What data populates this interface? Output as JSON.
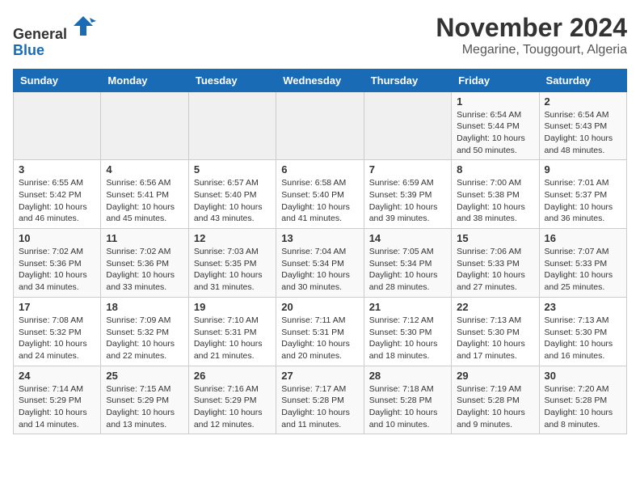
{
  "header": {
    "logo_line1": "General",
    "logo_line2": "Blue",
    "main_title": "November 2024",
    "subtitle": "Megarine, Touggourt, Algeria"
  },
  "days_of_week": [
    "Sunday",
    "Monday",
    "Tuesday",
    "Wednesday",
    "Thursday",
    "Friday",
    "Saturday"
  ],
  "weeks": [
    [
      {
        "day": "",
        "info": ""
      },
      {
        "day": "",
        "info": ""
      },
      {
        "day": "",
        "info": ""
      },
      {
        "day": "",
        "info": ""
      },
      {
        "day": "",
        "info": ""
      },
      {
        "day": "1",
        "info": "Sunrise: 6:54 AM\nSunset: 5:44 PM\nDaylight: 10 hours\nand 50 minutes."
      },
      {
        "day": "2",
        "info": "Sunrise: 6:54 AM\nSunset: 5:43 PM\nDaylight: 10 hours\nand 48 minutes."
      }
    ],
    [
      {
        "day": "3",
        "info": "Sunrise: 6:55 AM\nSunset: 5:42 PM\nDaylight: 10 hours\nand 46 minutes."
      },
      {
        "day": "4",
        "info": "Sunrise: 6:56 AM\nSunset: 5:41 PM\nDaylight: 10 hours\nand 45 minutes."
      },
      {
        "day": "5",
        "info": "Sunrise: 6:57 AM\nSunset: 5:40 PM\nDaylight: 10 hours\nand 43 minutes."
      },
      {
        "day": "6",
        "info": "Sunrise: 6:58 AM\nSunset: 5:40 PM\nDaylight: 10 hours\nand 41 minutes."
      },
      {
        "day": "7",
        "info": "Sunrise: 6:59 AM\nSunset: 5:39 PM\nDaylight: 10 hours\nand 39 minutes."
      },
      {
        "day": "8",
        "info": "Sunrise: 7:00 AM\nSunset: 5:38 PM\nDaylight: 10 hours\nand 38 minutes."
      },
      {
        "day": "9",
        "info": "Sunrise: 7:01 AM\nSunset: 5:37 PM\nDaylight: 10 hours\nand 36 minutes."
      }
    ],
    [
      {
        "day": "10",
        "info": "Sunrise: 7:02 AM\nSunset: 5:36 PM\nDaylight: 10 hours\nand 34 minutes."
      },
      {
        "day": "11",
        "info": "Sunrise: 7:02 AM\nSunset: 5:36 PM\nDaylight: 10 hours\nand 33 minutes."
      },
      {
        "day": "12",
        "info": "Sunrise: 7:03 AM\nSunset: 5:35 PM\nDaylight: 10 hours\nand 31 minutes."
      },
      {
        "day": "13",
        "info": "Sunrise: 7:04 AM\nSunset: 5:34 PM\nDaylight: 10 hours\nand 30 minutes."
      },
      {
        "day": "14",
        "info": "Sunrise: 7:05 AM\nSunset: 5:34 PM\nDaylight: 10 hours\nand 28 minutes."
      },
      {
        "day": "15",
        "info": "Sunrise: 7:06 AM\nSunset: 5:33 PM\nDaylight: 10 hours\nand 27 minutes."
      },
      {
        "day": "16",
        "info": "Sunrise: 7:07 AM\nSunset: 5:33 PM\nDaylight: 10 hours\nand 25 minutes."
      }
    ],
    [
      {
        "day": "17",
        "info": "Sunrise: 7:08 AM\nSunset: 5:32 PM\nDaylight: 10 hours\nand 24 minutes."
      },
      {
        "day": "18",
        "info": "Sunrise: 7:09 AM\nSunset: 5:32 PM\nDaylight: 10 hours\nand 22 minutes."
      },
      {
        "day": "19",
        "info": "Sunrise: 7:10 AM\nSunset: 5:31 PM\nDaylight: 10 hours\nand 21 minutes."
      },
      {
        "day": "20",
        "info": "Sunrise: 7:11 AM\nSunset: 5:31 PM\nDaylight: 10 hours\nand 20 minutes."
      },
      {
        "day": "21",
        "info": "Sunrise: 7:12 AM\nSunset: 5:30 PM\nDaylight: 10 hours\nand 18 minutes."
      },
      {
        "day": "22",
        "info": "Sunrise: 7:13 AM\nSunset: 5:30 PM\nDaylight: 10 hours\nand 17 minutes."
      },
      {
        "day": "23",
        "info": "Sunrise: 7:13 AM\nSunset: 5:30 PM\nDaylight: 10 hours\nand 16 minutes."
      }
    ],
    [
      {
        "day": "24",
        "info": "Sunrise: 7:14 AM\nSunset: 5:29 PM\nDaylight: 10 hours\nand 14 minutes."
      },
      {
        "day": "25",
        "info": "Sunrise: 7:15 AM\nSunset: 5:29 PM\nDaylight: 10 hours\nand 13 minutes."
      },
      {
        "day": "26",
        "info": "Sunrise: 7:16 AM\nSunset: 5:29 PM\nDaylight: 10 hours\nand 12 minutes."
      },
      {
        "day": "27",
        "info": "Sunrise: 7:17 AM\nSunset: 5:28 PM\nDaylight: 10 hours\nand 11 minutes."
      },
      {
        "day": "28",
        "info": "Sunrise: 7:18 AM\nSunset: 5:28 PM\nDaylight: 10 hours\nand 10 minutes."
      },
      {
        "day": "29",
        "info": "Sunrise: 7:19 AM\nSunset: 5:28 PM\nDaylight: 10 hours\nand 9 minutes."
      },
      {
        "day": "30",
        "info": "Sunrise: 7:20 AM\nSunset: 5:28 PM\nDaylight: 10 hours\nand 8 minutes."
      }
    ]
  ]
}
